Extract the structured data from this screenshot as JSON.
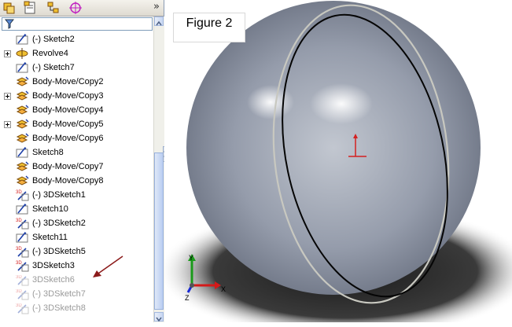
{
  "panel": {
    "more_glyph": "»",
    "tabs": [
      {
        "name": "feature-manager-tab",
        "icon": "feature-tree-icon"
      },
      {
        "name": "property-manager-tab",
        "icon": "property-manager-icon"
      },
      {
        "name": "configuration-manager-tab",
        "icon": "configuration-manager-icon"
      },
      {
        "name": "dimxpert-manager-tab",
        "icon": "target-icon"
      }
    ],
    "filter_icon": "funnel-icon",
    "tree": [
      {
        "label": "(-) Sketch2",
        "icon": "sketch-icon",
        "expander": false,
        "dim": false
      },
      {
        "label": "Revolve4",
        "icon": "revolve-icon",
        "expander": true,
        "dim": false
      },
      {
        "label": "(-) Sketch7",
        "icon": "sketch-icon",
        "expander": false,
        "dim": false
      },
      {
        "label": "Body-Move/Copy2",
        "icon": "body-move-copy-icon",
        "expander": false,
        "dim": false
      },
      {
        "label": "Body-Move/Copy3",
        "icon": "body-move-copy-icon",
        "expander": true,
        "dim": false
      },
      {
        "label": "Body-Move/Copy4",
        "icon": "body-move-copy-icon",
        "expander": false,
        "dim": false
      },
      {
        "label": "Body-Move/Copy5",
        "icon": "body-move-copy-icon",
        "expander": true,
        "dim": false
      },
      {
        "label": "Body-Move/Copy6",
        "icon": "body-move-copy-icon",
        "expander": false,
        "dim": false
      },
      {
        "label": "Sketch8",
        "icon": "sketch-icon",
        "expander": false,
        "dim": false
      },
      {
        "label": "Body-Move/Copy7",
        "icon": "body-move-copy-icon",
        "expander": false,
        "dim": false
      },
      {
        "label": "Body-Move/Copy8",
        "icon": "body-move-copy-icon",
        "expander": false,
        "dim": false
      },
      {
        "label": "(-) 3DSketch1",
        "icon": "3d-sketch-icon",
        "expander": false,
        "dim": false
      },
      {
        "label": "Sketch10",
        "icon": "sketch-icon",
        "expander": false,
        "dim": false
      },
      {
        "label": "(-) 3DSketch2",
        "icon": "3d-sketch-icon",
        "expander": false,
        "dim": false
      },
      {
        "label": "Sketch11",
        "icon": "sketch-icon",
        "expander": false,
        "dim": false
      },
      {
        "label": "(-) 3DSketch5",
        "icon": "3d-sketch-icon",
        "expander": false,
        "dim": false
      },
      {
        "label": "3DSketch3",
        "icon": "3d-sketch-icon",
        "expander": false,
        "dim": false
      },
      {
        "label": "3DSketch6",
        "icon": "3d-sketch-icon",
        "expander": false,
        "dim": true
      },
      {
        "label": "(-) 3DSketch7",
        "icon": "3d-sketch-icon",
        "expander": false,
        "dim": true
      },
      {
        "label": "(-) 3DSketch8",
        "icon": "3d-sketch-icon",
        "expander": false,
        "dim": true
      }
    ]
  },
  "viewport": {
    "figure_label": "Figure 2",
    "triad_axes": [
      "Y",
      "X",
      "Z"
    ]
  },
  "colors": {
    "annotation_arrow": "#8b1a1a",
    "sphere_base": "#8c93a0",
    "origin": "#d42020"
  }
}
